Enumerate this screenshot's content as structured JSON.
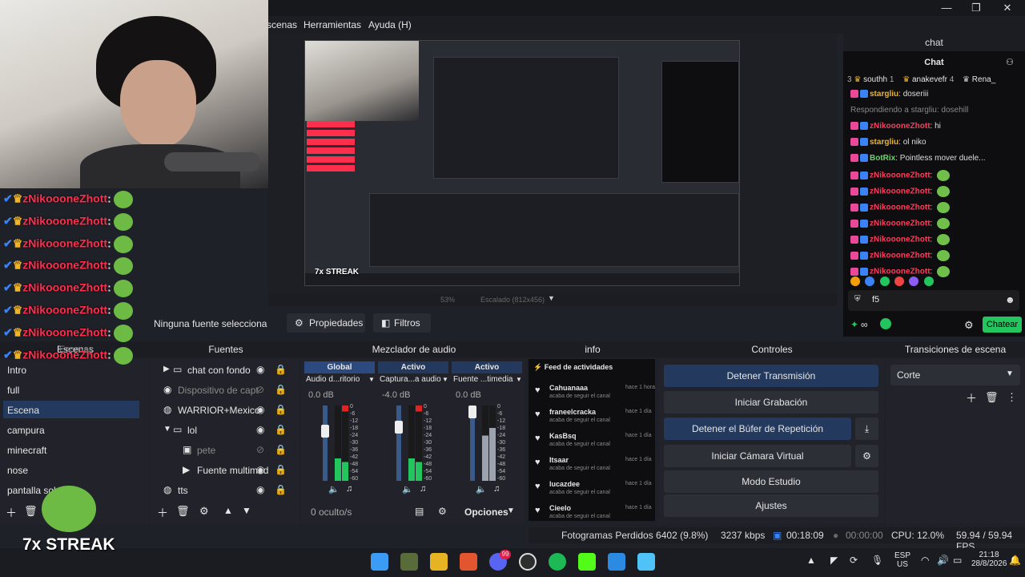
{
  "menu": {
    "escenas": "scenas",
    "herramientas": "Herramientas",
    "ayuda": "Ayuda (H)"
  },
  "window_controls": {
    "minimize": "—",
    "maximize": "❐",
    "close": "✕"
  },
  "overlay_chat": {
    "username": "zNikoooneZhott",
    "lines": 8,
    "escenas_label": "Escenas"
  },
  "preview": {
    "streak_label": "7x STREAK",
    "scale_label": "Escalado (812x456)",
    "zoom": "53%"
  },
  "source_bar": {
    "no_source": "Ninguna fuente selecciona",
    "properties": "Propiedades",
    "filters": "Filtros"
  },
  "chat_dock": {
    "window_title": "chat",
    "header": "Chat",
    "top_viewers": [
      {
        "rank": "3",
        "name": "southh",
        "count": "1"
      },
      {
        "name": "anakevefr",
        "count": "4"
      },
      {
        "name": "Rena_"
      }
    ],
    "messages": [
      {
        "name": "stargliu",
        "text": "doseriii",
        "color": "#f0b429"
      },
      {
        "name": "",
        "text": "Respondiendo a stargliu: dosehill",
        "color": "#888888"
      },
      {
        "name": "zNikoooneZhott",
        "text": "hi",
        "color": "#ff3b5b"
      },
      {
        "name": "stargliu",
        "text": "ol niko",
        "color": "#f0b429"
      },
      {
        "name": "BotRix",
        "text": "Pointless mover duele...",
        "color": "#6bd36b"
      },
      {
        "name": "zNikoooneZhott",
        "text": "",
        "color": "#ff3b5b"
      },
      {
        "name": "zNikoooneZhott",
        "text": "",
        "color": "#ff3b5b"
      },
      {
        "name": "zNikoooneZhott",
        "text": "",
        "color": "#ff3b5b"
      },
      {
        "name": "zNikoooneZhott",
        "text": "",
        "color": "#ff3b5b"
      },
      {
        "name": "zNikoooneZhott",
        "text": "",
        "color": "#ff3b5b"
      },
      {
        "name": "zNikoooneZhott",
        "text": "",
        "color": "#ff3b5b"
      },
      {
        "name": "zNikoooneZhott",
        "text": "",
        "color": "#ff3b5b"
      }
    ],
    "input_value": "f5",
    "send_button": "Chatear",
    "points": "∞"
  },
  "docks": {
    "scenes": "Escenas",
    "sources": "Fuentes",
    "mixer": "Mezclador de audio",
    "info": "info",
    "controls": "Controles",
    "transitions": "Transiciones de escena"
  },
  "scenes": [
    "Intro",
    "full",
    "Escena",
    "campura",
    "minecraft",
    "nose",
    "pantalla sol"
  ],
  "selected_scene": "Escena",
  "sources": [
    {
      "name": "chat con fondo",
      "icon": "folder",
      "visible": true,
      "indent": 1,
      "expand": "▶"
    },
    {
      "name": "Dispositivo de capt",
      "icon": "camera",
      "visible": false,
      "indent": 0
    },
    {
      "name": "WARRIOR+Mexico",
      "icon": "globe",
      "visible": true,
      "indent": 0
    },
    {
      "name": "lol",
      "icon": "folder",
      "visible": true,
      "indent": 1,
      "expand": "▼"
    },
    {
      "name": "pete",
      "icon": "image",
      "visible": false,
      "indent": 2
    },
    {
      "name": "Fuente multimed",
      "icon": "play",
      "visible": true,
      "indent": 2
    },
    {
      "name": "tts",
      "icon": "globe",
      "visible": true,
      "indent": 0
    }
  ],
  "mixer": {
    "channels": [
      {
        "tab": "Global",
        "name": "Audio d...ritorio",
        "db": "0.0 dB",
        "level": 0.25
      },
      {
        "tab": "Activo",
        "name": "Captura...a audio",
        "db": "-4.0 dB",
        "level": 0.2
      },
      {
        "tab": "Activo",
        "name": "Fuente ...timedia",
        "db": "0.0 dB",
        "level": 0.0
      }
    ],
    "scale": [
      "0",
      "-6",
      "-12",
      "-18",
      "-24",
      "-30",
      "-36",
      "-42",
      "-48",
      "-54",
      "-60"
    ],
    "hidden": "0 oculto/s",
    "options": "Opciones"
  },
  "feed": {
    "title": "Feed de actividades",
    "items": [
      {
        "name": "Cahuanaaa",
        "action": "acaba de seguir el canal",
        "time": "hace 1 hora"
      },
      {
        "name": "franeelcracka",
        "action": "acaba de seguir el canal",
        "time": "hace 1 día"
      },
      {
        "name": "KasBsq",
        "action": "acaba de seguir el canal",
        "time": "hace 1 día"
      },
      {
        "name": "Itsaar",
        "action": "acaba de seguir el canal",
        "time": "hace 1 día"
      },
      {
        "name": "lucazdee",
        "action": "acaba de seguir el canal",
        "time": "hace 1 día"
      },
      {
        "name": "Cieelo",
        "action": "acaba de seguir el canal",
        "time": "hace 1 día"
      }
    ]
  },
  "controls": {
    "stop_stream": "Detener Transmisión",
    "start_record": "Iniciar Grabación",
    "stop_replay": "Detener el Búfer de Repetición",
    "virtual_cam": "Iniciar Cámara Virtual",
    "studio_mode": "Modo Estudio",
    "settings": "Ajustes"
  },
  "transitions": {
    "selected": "Corte"
  },
  "status": {
    "dropped_frames": "Fotogramas Perdidos 6402 (9.8%)",
    "bitrate": "3237 kbps",
    "stream_time": "00:18:09",
    "record_time": "00:00:00",
    "cpu": "CPU: 12.0%",
    "fps": "59.94 / 59.94 FPS"
  },
  "taskbar": {
    "lang": "ESP",
    "region": "US",
    "time": "21:18",
    "date": "28/8/2026",
    "notif_badge": "99"
  },
  "overlay_bottom": {
    "streak": "7x STREAK"
  },
  "colors": {
    "accent": "#23395d",
    "red": "#ff2e4d",
    "green": "#6dbb45",
    "chat_send": "#22c55e"
  }
}
